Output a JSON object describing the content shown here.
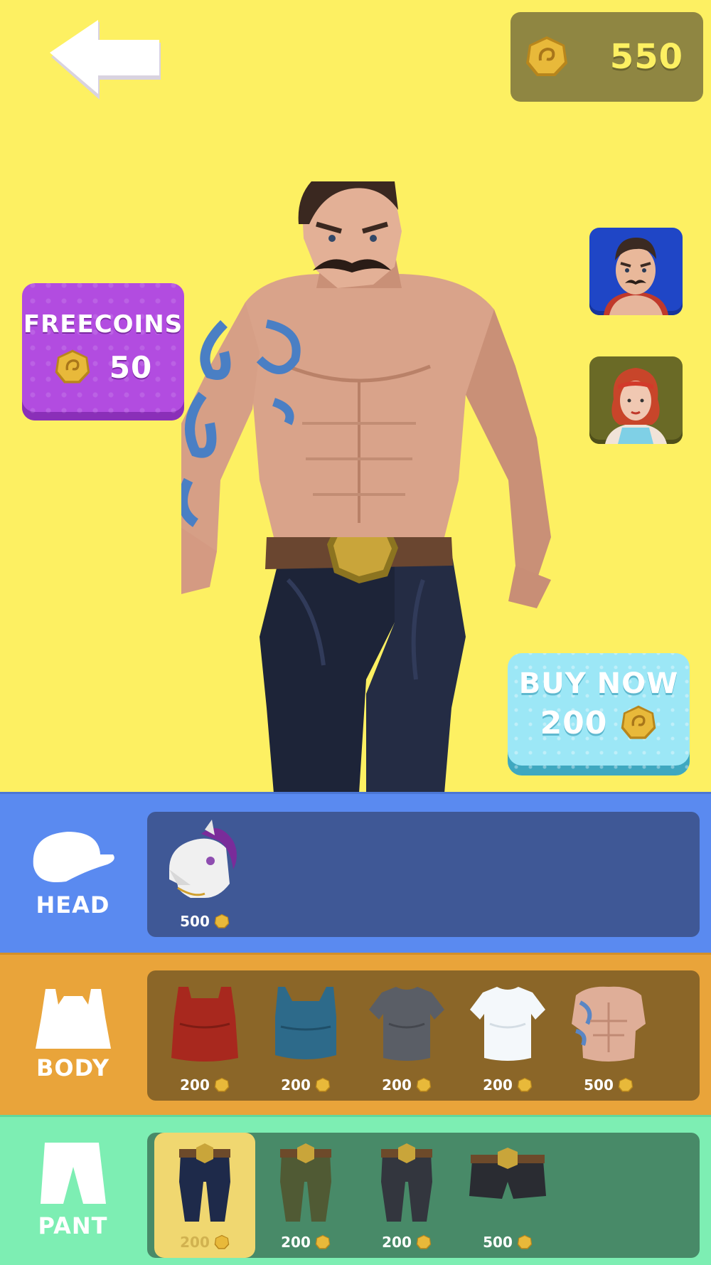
{
  "header": {
    "coin_balance": "550"
  },
  "freecoins": {
    "title": "FREECOINS",
    "amount": "50"
  },
  "buy_now": {
    "title": "BUY NOW",
    "price": "200"
  },
  "character_select": [
    {
      "name": "male-brawler"
    },
    {
      "name": "female-redhead"
    }
  ],
  "categories": {
    "head": {
      "label": "HEAD",
      "items": [
        {
          "name": "horse-mask",
          "price": "500"
        }
      ]
    },
    "body": {
      "label": "BODY",
      "items": [
        {
          "name": "red-tank-top",
          "price": "200"
        },
        {
          "name": "blue-tank-top",
          "price": "200"
        },
        {
          "name": "grey-tshirt",
          "price": "200"
        },
        {
          "name": "white-tshirt",
          "price": "200"
        },
        {
          "name": "tattoo-torso",
          "price": "500"
        }
      ]
    },
    "pant": {
      "label": "PANT",
      "items": [
        {
          "name": "navy-pants",
          "price": "200",
          "selected": true
        },
        {
          "name": "olive-pants",
          "price": "200"
        },
        {
          "name": "dark-grey-pants",
          "price": "200"
        },
        {
          "name": "black-shorts",
          "price": "500"
        }
      ]
    }
  },
  "colors": {
    "background": "#fdf062",
    "head_row": "#5a8af0",
    "body_row": "#e9a43a",
    "pant_row": "#7deeb3",
    "freecoins": "#b24ce0",
    "buy_now": "#9ce7f6",
    "coin": "#d9a72a"
  }
}
